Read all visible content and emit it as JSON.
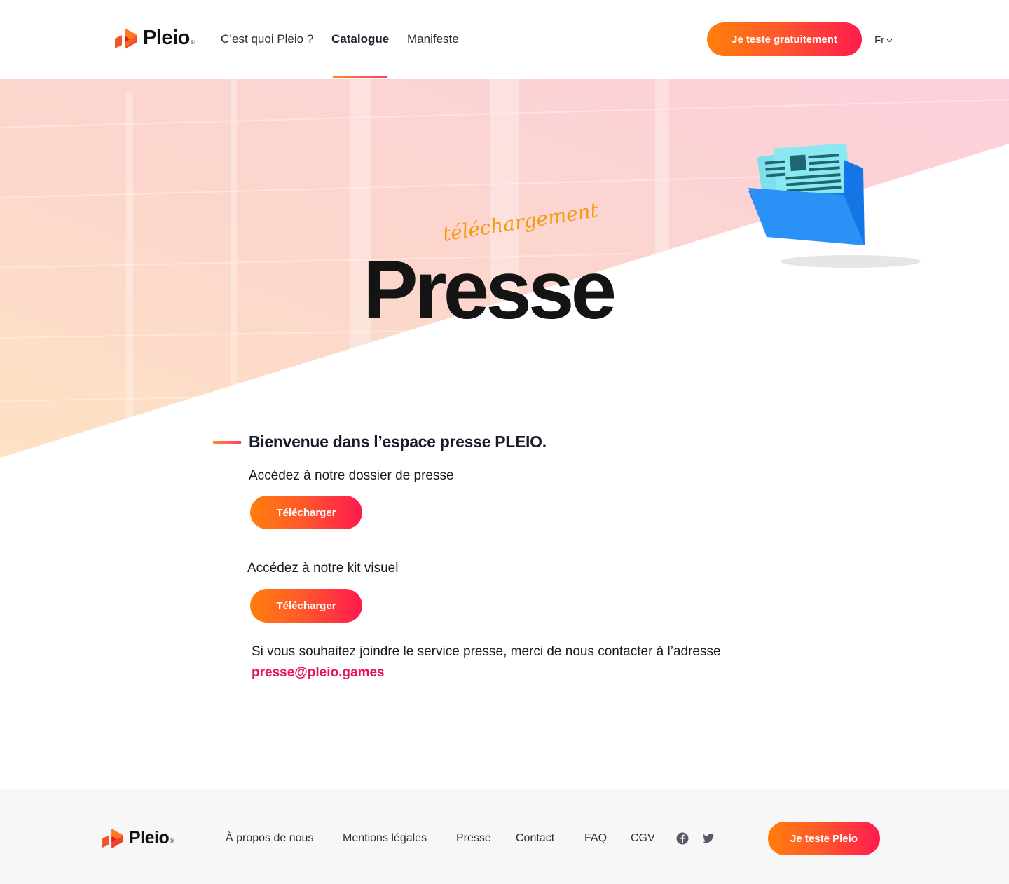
{
  "brand": {
    "name": "Pleio",
    "registered": "®"
  },
  "colors": {
    "accent_orange": "#ff7e0c",
    "accent_red": "#ff1a4e",
    "email": "#e8134f",
    "text_dark": "#1a1a1a",
    "footer_bg": "#f7f7f7"
  },
  "header": {
    "nav": [
      {
        "label": "C’est quoi Pleio ?"
      },
      {
        "label": "Catalogue",
        "active": true
      },
      {
        "label": "Manifeste"
      }
    ],
    "cta_label": "Je teste gratuitement",
    "language": "Fr"
  },
  "hero": {
    "script_text": "téléchargement",
    "title": "Presse",
    "illustration": "folder-with-newspaper-icon"
  },
  "content": {
    "welcome": "Bienvenue dans l’espace presse PLEIO.",
    "press_kit_label": "Accédez à notre dossier de presse",
    "press_kit_button": "Télécharger",
    "visual_kit_label": "Accédez à notre kit visuel",
    "visual_kit_button": "Télécharger",
    "contact_text": "Si vous souhaitez joindre le service presse, merci de nous contacter à l’adresse",
    "email": "presse@pleio.games"
  },
  "footer": {
    "links": [
      {
        "label": "À propos de nous"
      },
      {
        "label": "Mentions légales"
      },
      {
        "label": "Presse"
      },
      {
        "label": "Contact"
      },
      {
        "label": "FAQ"
      },
      {
        "label": "CGV"
      }
    ],
    "social": [
      "facebook-icon",
      "twitter-icon"
    ],
    "cta_label": "Je teste Pleio"
  }
}
